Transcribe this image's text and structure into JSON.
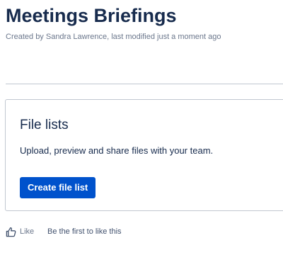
{
  "page": {
    "title": "Meetings Briefings",
    "byline": "Created by Sandra Lawrence, last modified just a moment ago"
  },
  "card": {
    "title": "File lists",
    "description": "Upload, preview and share files with your team.",
    "button_label": "Create file list"
  },
  "likes": {
    "icon": "thumbs-up-icon",
    "label": "Like",
    "note": "Be the first to like this"
  },
  "colors": {
    "primary_button": "#0052cc",
    "heading_text": "#172b4d",
    "muted_text": "#6b778c",
    "border": "#c1c7d0"
  }
}
